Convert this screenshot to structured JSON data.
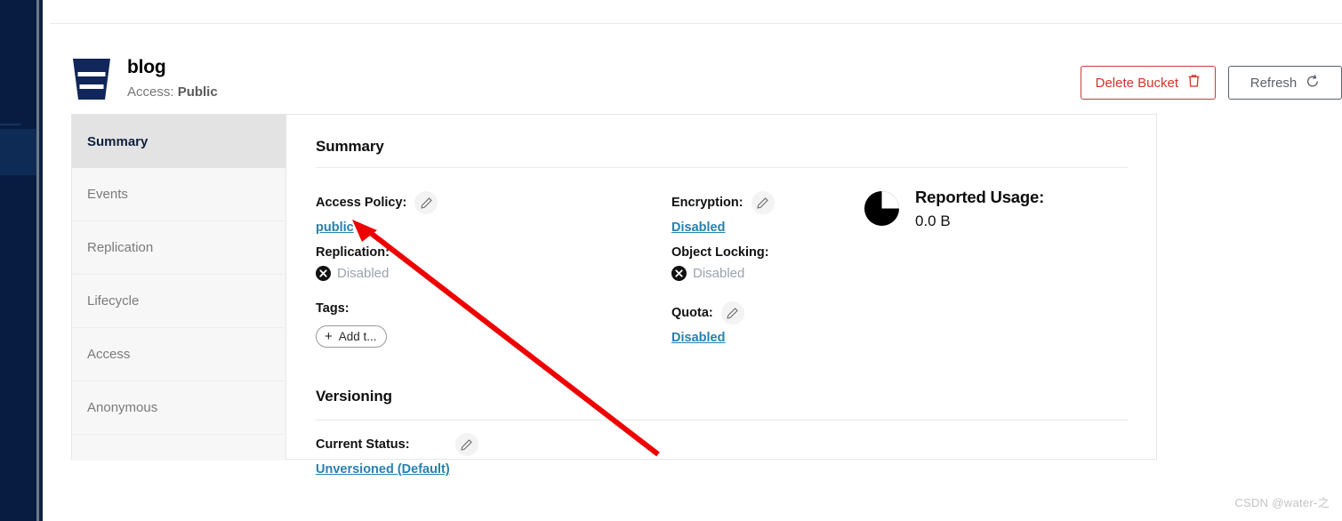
{
  "left_nav": {
    "name": "collapsed-console-nav"
  },
  "bucket": {
    "icon": "bucket-icon",
    "name": "blog",
    "access_label": "Access:",
    "access_value": "Public"
  },
  "header_actions": {
    "delete_label": "Delete Bucket",
    "delete_icon": "trash-icon",
    "refresh_label": "Refresh",
    "refresh_icon": "refresh-icon"
  },
  "side_tabs": [
    {
      "label": "Summary",
      "active": true
    },
    {
      "label": "Events",
      "active": false
    },
    {
      "label": "Replication",
      "active": false
    },
    {
      "label": "Lifecycle",
      "active": false
    },
    {
      "label": "Access",
      "active": false
    },
    {
      "label": "Anonymous",
      "active": false
    }
  ],
  "summary": {
    "title": "Summary",
    "access_policy": {
      "label": "Access Policy:",
      "value": "public",
      "edit_icon": "pencil-icon"
    },
    "replication": {
      "label": "Replication:",
      "value": "Disabled",
      "status_icon": "x-circle-icon"
    },
    "tags": {
      "label": "Tags:",
      "add_label": "Add t...",
      "add_icon": "plus-icon"
    },
    "encryption": {
      "label": "Encryption:",
      "value": "Disabled",
      "edit_icon": "pencil-icon"
    },
    "object_locking": {
      "label": "Object Locking:",
      "value": "Disabled",
      "status_icon": "x-circle-icon"
    },
    "quota": {
      "label": "Quota:",
      "value": "Disabled",
      "edit_icon": "pencil-icon"
    },
    "usage": {
      "icon": "pie-chart-icon",
      "title": "Reported Usage:",
      "value": "0.0 B"
    }
  },
  "versioning": {
    "title": "Versioning",
    "status_label": "Current Status:",
    "status_value": "Unversioned (Default)",
    "edit_icon": "pencil-icon"
  },
  "annotation": {
    "type": "red-arrow",
    "points_at": "public"
  },
  "watermark": {
    "text": "CSDN @water-之"
  },
  "colors": {
    "nav_navy": "#081c42",
    "link_blue": "#2781b0",
    "danger_red": "#d0342c",
    "annotation_red": "#ee0000",
    "sidebar_bg": "#f7f7f7",
    "active_tab_bg": "#e3e3e3"
  }
}
